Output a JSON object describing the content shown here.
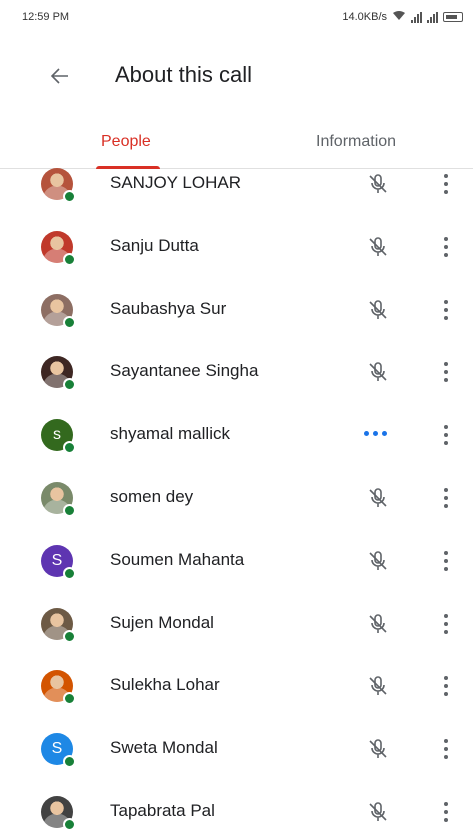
{
  "status_bar": {
    "time": "12:59 PM",
    "network_speed": "14.0KB/s"
  },
  "app_bar": {
    "back_icon": "arrow-back-icon",
    "title": "About this call"
  },
  "tabs": [
    {
      "label": "People",
      "active": true
    },
    {
      "label": "Information",
      "active": false
    }
  ],
  "colors": {
    "accent_red": "#d93025",
    "online_green": "#188038",
    "speaking_blue": "#1a73e8"
  },
  "participants": [
    {
      "name": "SANJOY LOHAR",
      "avatar_type": "photo",
      "avatar_color": "#b5533c",
      "status": "muted"
    },
    {
      "name": "Sanju Dutta",
      "avatar_type": "photo",
      "avatar_color": "#c0392b",
      "status": "muted"
    },
    {
      "name": "Saubashya Sur",
      "avatar_type": "photo",
      "avatar_color": "#8d6e63",
      "status": "muted"
    },
    {
      "name": "Sayantanee Singha",
      "avatar_type": "photo",
      "avatar_color": "#3e2723",
      "status": "muted"
    },
    {
      "name": "shyamal mallick",
      "avatar_type": "initial",
      "initial": "s",
      "avatar_color": "#33691e",
      "status": "speaking"
    },
    {
      "name": "somen dey",
      "avatar_type": "photo",
      "avatar_color": "#7a8a6a",
      "status": "muted"
    },
    {
      "name": "Soumen Mahanta",
      "avatar_type": "initial",
      "initial": "S",
      "avatar_color": "#5e35b1",
      "status": "muted"
    },
    {
      "name": "Sujen Mondal",
      "avatar_type": "photo",
      "avatar_color": "#6d5a45",
      "status": "muted"
    },
    {
      "name": "Sulekha Lohar",
      "avatar_type": "photo",
      "avatar_color": "#d35400",
      "status": "muted"
    },
    {
      "name": "Sweta Mondal",
      "avatar_type": "initial",
      "initial": "S",
      "avatar_color": "#1e88e5",
      "status": "muted"
    },
    {
      "name": "Tapabrata Pal",
      "avatar_type": "photo",
      "avatar_color": "#424242",
      "status": "muted"
    }
  ]
}
